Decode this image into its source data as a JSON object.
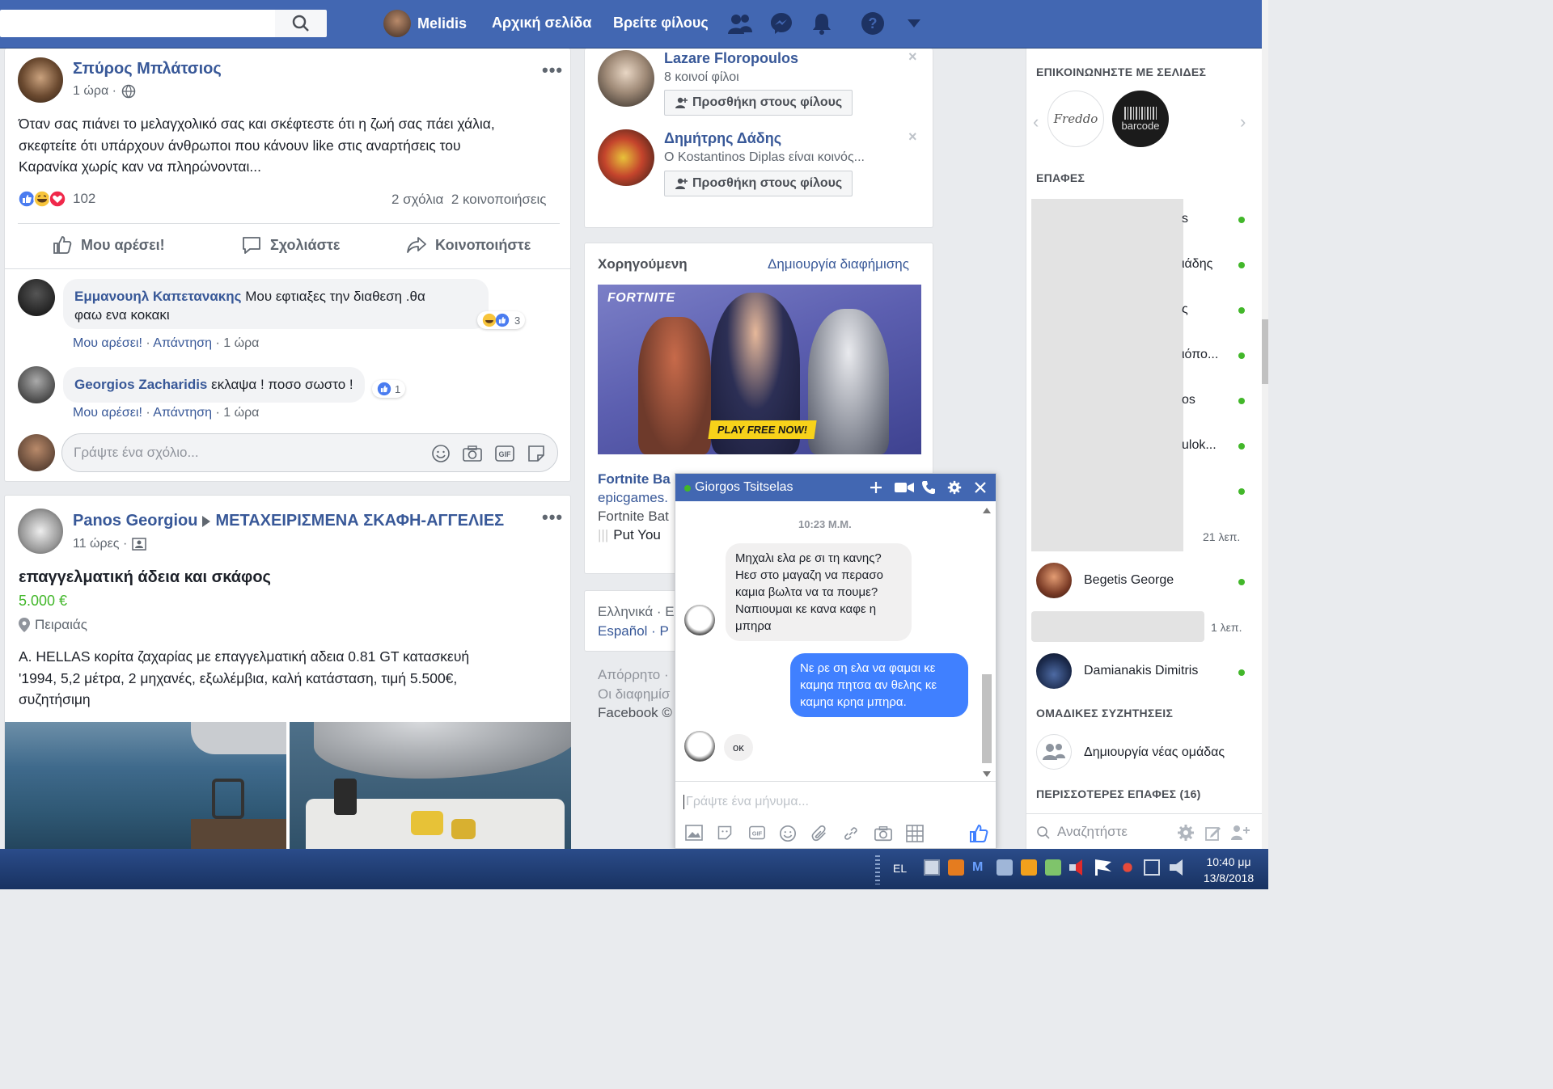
{
  "topbar": {
    "user_name": "Melidis",
    "home": "Αρχική σελίδα",
    "find_friends": "Βρείτε φίλους"
  },
  "post1": {
    "author": "Σπύρος Μπλάτσιος",
    "time": "1 ώρα ·",
    "text_lines": [
      "Όταν σας πιάνει το μελαγχολικό σας και σκέφτεστε ότι η ζωή σας πάει χάλια,",
      "σκεφτείτε ότι υπάρχουν άνθρωποι που κάνουν like στις αναρτήσεις του",
      "Καρανίκα χωρίς καν να πληρώνονται..."
    ],
    "reactions_count": "102",
    "stats": "2 σχόλια  2 κοινοποιήσεις",
    "like_label": "Μου αρέσει!",
    "comment_label": "Σχολιάστε",
    "share_label": "Κοινοποιήστε",
    "comments": [
      {
        "author": "Εμμανουηλ Καπετανακης",
        "text_line1": "Μου εφτιαξες την διαθεση .θα",
        "text_line2": "φαω ενα κοκακι",
        "reaction_count": "3",
        "like": "Μου αρέσει!",
        "reply": "Απάντηση",
        "time": "· 1 ώρα"
      },
      {
        "author": "Georgios Zacharidis",
        "text": "εκλαψα ! ποσο σωστο !",
        "reaction_count": "1",
        "like": "Μου αρέσει!",
        "reply": "Απάντηση",
        "time": "· 1 ώρα"
      }
    ],
    "comment_placeholder": "Γράψτε ένα σχόλιο..."
  },
  "post2": {
    "author": "Panos Georgiou",
    "group": "ΜΕΤΑΧΕΙΡΙΣΜΕΝΑ ΣΚΑΦΗ-ΑΓΓΕΛΙΕΣ",
    "time": "11 ώρες ·",
    "title": "επαγγελματική άδεια και σκάφος",
    "price": "5.000 €",
    "location": "Πειραιάς",
    "text_lines": [
      "A. HELLAS κορίτα ζαχαρίας με επαγγελματική αδεια 0.81 GT κατασκευή",
      "'1994, 5,2 μέτρα, 2 μηχανές, εξωλέμβια, καλή κατάσταση, τιμή 5.500€,",
      "συζητήσιμη"
    ]
  },
  "suggestions": [
    {
      "name": "Lazare Floropoulos",
      "sub": "8 κοινοί φίλοι",
      "button": "Προσθήκη στους φίλους"
    },
    {
      "name": "Δημήτρης Δάδης",
      "sub": "Ο Kostantinos Diplas είναι κοινός...",
      "button": "Προσθήκη στους φίλους"
    }
  ],
  "sponsored": {
    "header": "Χορηγούμενη",
    "create_ad": "Δημιουργία διαφήμισης",
    "ad_logo": "FORTNITE",
    "ad_cta": "PLAY FREE NOW!",
    "ad_title": "Fortnite Ba",
    "ad_domain": "epicgames.",
    "ad_text": "Fortnite Bat",
    "ad_text2": "Put You"
  },
  "languages": {
    "line1": "Ελληνικά · E",
    "line2": "Español · P"
  },
  "footer": {
    "line1": "Απόρρητο ·",
    "line2": "Οι διαφημίσ",
    "line3": "Facebook ©"
  },
  "right_sidebar": {
    "pages_head": "ΕΠΙΚΟΙΝΩΝΗΣΤΕ ΜΕ ΣΕΛΙΔΕΣ",
    "page1": "Freddo",
    "page2": "barcode",
    "contacts_head": "ΕΠΑΦΕΣ",
    "partial_contacts": [
      "s",
      "ιάδης",
      "ς",
      "ιόπο...",
      "os",
      "ulok...",
      ""
    ],
    "time_21": "21 λεπ.",
    "contact_begetis": "Begetis George",
    "time_1": "1 λεπ.",
    "contact_damianakis": "Damianakis Dimitris",
    "group_head": "ΟΜΑΔΙΚΕΣ ΣΥΖΗΤΗΣΕΙΣ",
    "new_group": "Δημιουργία νέας ομάδας",
    "more_head": "ΠΕΡΙΣΣΟΤΕΡΕΣ ΕΠΑΦΕΣ (16)",
    "search_placeholder": "Αναζητήστε"
  },
  "chat": {
    "name": "Giorgos Tsitselas",
    "time": "10:23 Μ.Μ.",
    "incoming1": [
      "Μηχαλι ελα ρε σι τη κανης?",
      "Ηεσ στο μαγαζη να περασο",
      "καμια βωλτα να τα πουμε?",
      "Ναπιουμαι κε κανα καφε η",
      "μπηρα"
    ],
    "outgoing1": [
      "Νε ρε ση ελα να φαμαι κε",
      "καμηα πητσα αν θελης κε",
      "καμηα κρηα μπηρα."
    ],
    "incoming2": "οκ",
    "input_placeholder": "Γράψτε ένα μήνυμα..."
  },
  "taskbar": {
    "lang": "EL",
    "time": "10:40 μμ",
    "date": "13/8/2018"
  },
  "colors": {
    "fb_blue": "#4267b2",
    "link": "#385898",
    "online": "#42b72a",
    "price_green": "#42b72a"
  }
}
